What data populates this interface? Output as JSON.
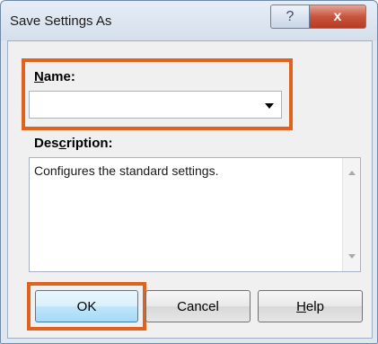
{
  "window": {
    "title": "Save Settings As",
    "help_glyph": "?",
    "close_glyph": "x"
  },
  "name": {
    "label_accel": "N",
    "label_rest": "ame:",
    "value": ""
  },
  "description": {
    "label_pre": "Des",
    "label_accel": "c",
    "label_post": "ription:",
    "text": "Configures the standard settings."
  },
  "buttons": {
    "ok": "OK",
    "cancel": "Cancel",
    "help_accel": "H",
    "help_rest": "elp"
  },
  "colors": {
    "highlight": "#e0621d",
    "close_button": "#c8553e",
    "ok_button": "#bee6fd"
  }
}
